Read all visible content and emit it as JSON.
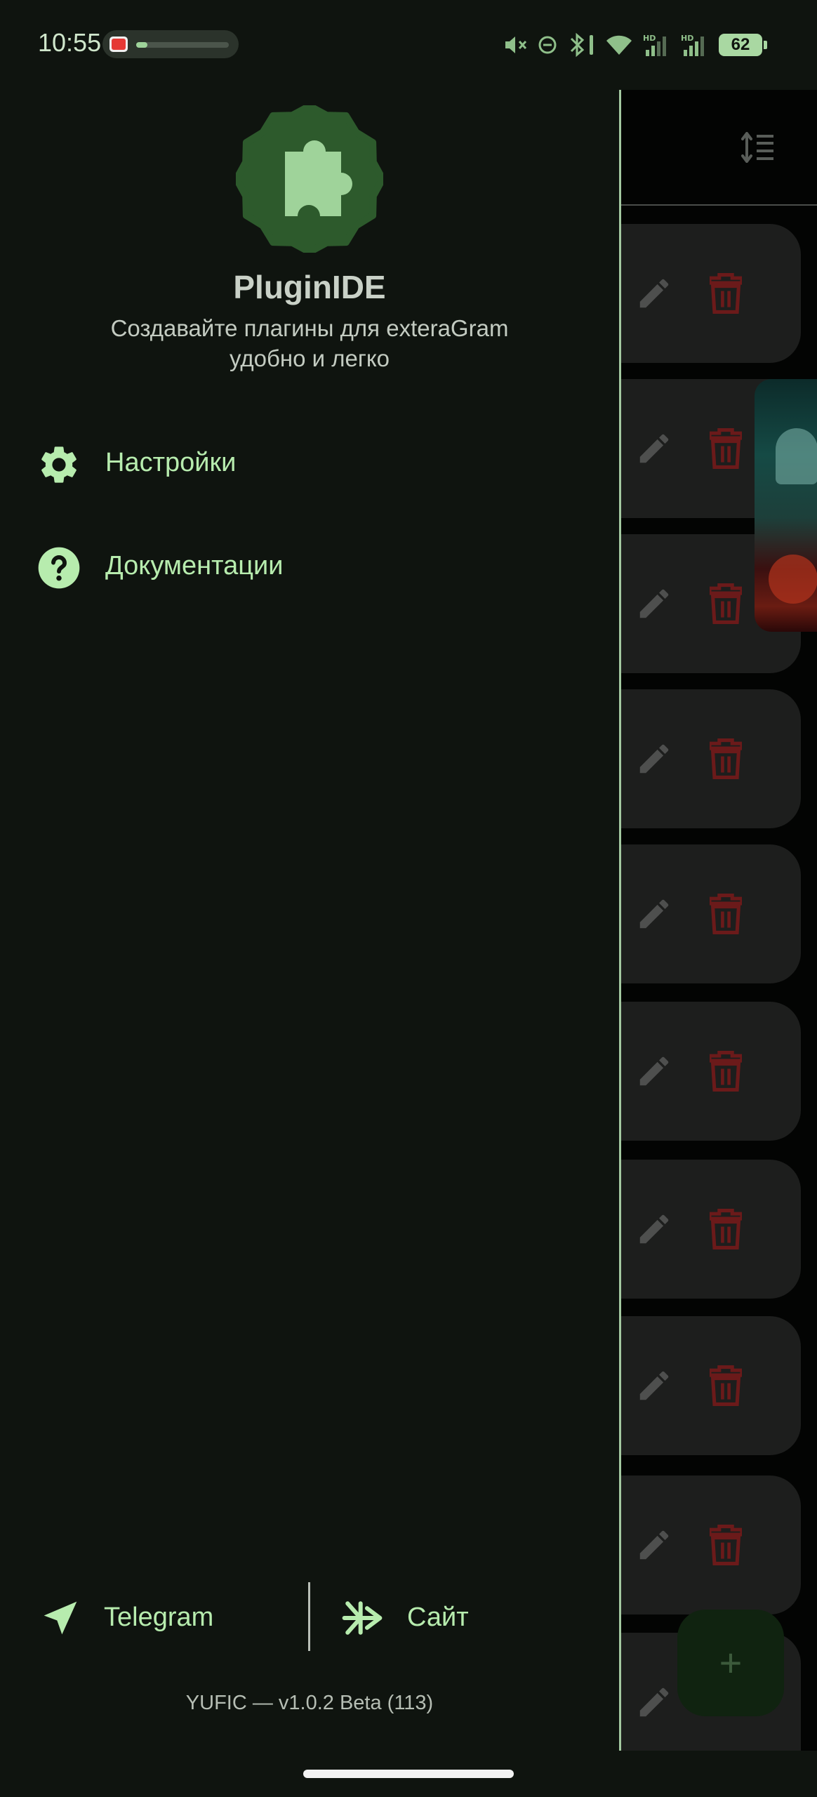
{
  "status_bar": {
    "time": "10:55",
    "battery": "62",
    "media_progress": 0.12
  },
  "drawer": {
    "app_name": "PluginIDE",
    "tagline": "Создавайте плагины для exteraGram удобно и легко",
    "menu": [
      {
        "label": "Настройки",
        "icon": "gear-icon"
      },
      {
        "label": "Документации",
        "icon": "help-icon"
      }
    ],
    "links": [
      {
        "label": "Telegram",
        "icon": "telegram-icon"
      },
      {
        "label": "Сайт",
        "icon": "site-icon"
      }
    ],
    "version": "YUFIC — v1.0.2 Beta (113)"
  },
  "main": {
    "fab_label": "+",
    "card_count": 10
  },
  "colors": {
    "background": "#0f140f",
    "accent": "#b7ecae",
    "logo_badge": "#2d5a2c",
    "delete": "#6b1a1a"
  }
}
